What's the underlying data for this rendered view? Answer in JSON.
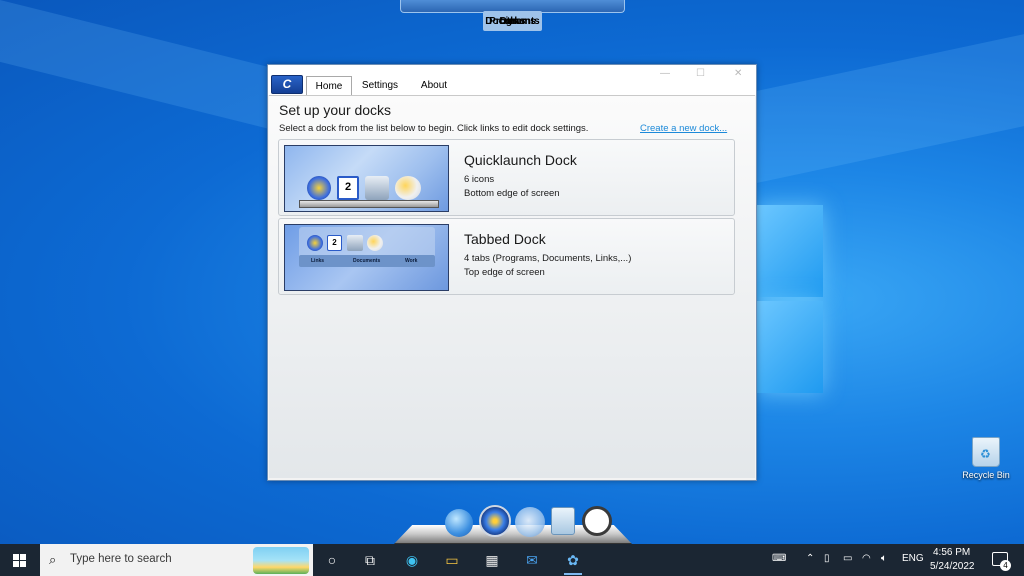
{
  "top_dock": {
    "tabs": [
      "Programs",
      "Documents",
      "Links",
      "Other"
    ]
  },
  "app": {
    "logo_text": "C",
    "tabs": [
      "Home",
      "Settings",
      "About"
    ],
    "active_tab": "Home",
    "title": "Set up your docks",
    "subtitle": "Select a dock from the list below to begin. Click links to edit dock settings.",
    "create_link": "Create a new dock...",
    "docks": [
      {
        "name": "Quicklaunch Dock",
        "detail1": "6 icons",
        "detail2": "Bottom edge of screen"
      },
      {
        "name": "Tabbed Dock",
        "detail1": "4 tabs (Programs, Documents, Links,...)",
        "detail2": "Top edge of screen",
        "thumb_tabs": [
          "Links",
          "Documents",
          "Work"
        ]
      }
    ]
  },
  "desktop": {
    "recycle_bin_label": "Recycle Bin"
  },
  "bottom_dock": {
    "icons": [
      "globe-icon",
      "windows-orb-icon",
      "weather-icon",
      "recycle-bin-icon",
      "clock-icon"
    ]
  },
  "taskbar": {
    "search_placeholder": "Type here to search",
    "language": "ENG",
    "time": "4:56 PM",
    "date": "5/24/2022",
    "notification_count": "4"
  },
  "colors": {
    "desktop_blue": "#0d6ad3",
    "link": "#1c8ad9",
    "taskbar": "#1b2633"
  }
}
